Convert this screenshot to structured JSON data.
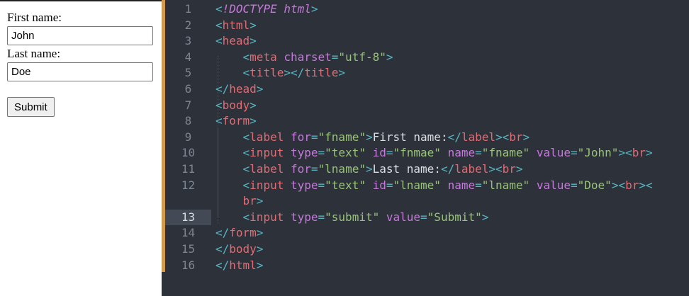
{
  "preview": {
    "first_name_label": "First name:",
    "first_name_value": "John",
    "last_name_label": "Last name:",
    "last_name_value": "Doe",
    "submit_label": "Submit"
  },
  "editor": {
    "active_line": 13,
    "lines": [
      {
        "n": "1",
        "indent": 0,
        "tokens": [
          [
            "p",
            "<"
          ],
          [
            "d",
            "!DOCTYPE html"
          ],
          [
            "p",
            ">"
          ]
        ]
      },
      {
        "n": "2",
        "indent": 0,
        "tokens": [
          [
            "p",
            "<"
          ],
          [
            "t",
            "html"
          ],
          [
            "p",
            ">"
          ]
        ]
      },
      {
        "n": "3",
        "indent": 0,
        "tokens": [
          [
            "p",
            "<"
          ],
          [
            "t",
            "head"
          ],
          [
            "p",
            ">"
          ]
        ]
      },
      {
        "n": "4",
        "indent": 1,
        "tokens": [
          [
            "p",
            "<"
          ],
          [
            "t",
            "meta"
          ],
          [
            "x",
            " "
          ],
          [
            "a",
            "charset"
          ],
          [
            "p",
            "="
          ],
          [
            "s",
            "\"utf-8\""
          ],
          [
            "p",
            ">"
          ]
        ]
      },
      {
        "n": "5",
        "indent": 1,
        "tokens": [
          [
            "p",
            "<"
          ],
          [
            "t",
            "title"
          ],
          [
            "p",
            "></"
          ],
          [
            "t",
            "title"
          ],
          [
            "p",
            ">"
          ]
        ]
      },
      {
        "n": "6",
        "indent": 0,
        "tokens": [
          [
            "p",
            "</"
          ],
          [
            "t",
            "head"
          ],
          [
            "p",
            ">"
          ]
        ]
      },
      {
        "n": "7",
        "indent": 0,
        "tokens": [
          [
            "p",
            "<"
          ],
          [
            "t",
            "body"
          ],
          [
            "p",
            ">"
          ]
        ]
      },
      {
        "n": "8",
        "indent": 0,
        "tokens": [
          [
            "p",
            "<"
          ],
          [
            "t",
            "form"
          ],
          [
            "p",
            ">"
          ]
        ]
      },
      {
        "n": "9",
        "indent": 1,
        "tokens": [
          [
            "p",
            "<"
          ],
          [
            "t",
            "label"
          ],
          [
            "x",
            " "
          ],
          [
            "a",
            "for"
          ],
          [
            "p",
            "="
          ],
          [
            "s",
            "\"fname\""
          ],
          [
            "p",
            ">"
          ],
          [
            "x",
            "First name:"
          ],
          [
            "p",
            "</"
          ],
          [
            "t",
            "label"
          ],
          [
            "p",
            "><"
          ],
          [
            "t",
            "br"
          ],
          [
            "p",
            ">"
          ]
        ]
      },
      {
        "n": "10",
        "indent": 1,
        "tokens": [
          [
            "p",
            "<"
          ],
          [
            "t",
            "input"
          ],
          [
            "x",
            " "
          ],
          [
            "a",
            "type"
          ],
          [
            "p",
            "="
          ],
          [
            "s",
            "\"text\""
          ],
          [
            "x",
            " "
          ],
          [
            "a",
            "id"
          ],
          [
            "p",
            "="
          ],
          [
            "s",
            "\"fnmae\""
          ],
          [
            "x",
            " "
          ],
          [
            "a",
            "name"
          ],
          [
            "p",
            "="
          ],
          [
            "s",
            "\"fname\""
          ],
          [
            "x",
            " "
          ],
          [
            "a",
            "value"
          ],
          [
            "p",
            "="
          ],
          [
            "s",
            "\"John\""
          ],
          [
            "p",
            "><"
          ],
          [
            "t",
            "br"
          ],
          [
            "p",
            ">"
          ]
        ]
      },
      {
        "n": "11",
        "indent": 1,
        "tokens": [
          [
            "p",
            "<"
          ],
          [
            "t",
            "label"
          ],
          [
            "x",
            " "
          ],
          [
            "a",
            "for"
          ],
          [
            "p",
            "="
          ],
          [
            "s",
            "\"lname\""
          ],
          [
            "p",
            ">"
          ],
          [
            "x",
            "Last name:"
          ],
          [
            "p",
            "</"
          ],
          [
            "t",
            "label"
          ],
          [
            "p",
            "><"
          ],
          [
            "t",
            "br"
          ],
          [
            "p",
            ">"
          ]
        ]
      },
      {
        "n": "12",
        "indent": 1,
        "tokens": [
          [
            "p",
            "<"
          ],
          [
            "t",
            "input"
          ],
          [
            "x",
            " "
          ],
          [
            "a",
            "type"
          ],
          [
            "p",
            "="
          ],
          [
            "s",
            "\"text\""
          ],
          [
            "x",
            " "
          ],
          [
            "a",
            "id"
          ],
          [
            "p",
            "="
          ],
          [
            "s",
            "\"lname\""
          ],
          [
            "x",
            " "
          ],
          [
            "a",
            "name"
          ],
          [
            "p",
            "="
          ],
          [
            "s",
            "\"lname\""
          ],
          [
            "x",
            " "
          ],
          [
            "a",
            "value"
          ],
          [
            "p",
            "="
          ],
          [
            "s",
            "\"Doe\""
          ],
          [
            "p",
            "><"
          ],
          [
            "t",
            "br"
          ],
          [
            "p",
            "><"
          ]
        ]
      },
      {
        "n": "",
        "indent": 1,
        "tokens": [
          [
            "t",
            "br"
          ],
          [
            "p",
            ">"
          ]
        ]
      },
      {
        "n": "13",
        "indent": 1,
        "tokens": [
          [
            "p",
            "<"
          ],
          [
            "t",
            "input"
          ],
          [
            "x",
            " "
          ],
          [
            "a",
            "type"
          ],
          [
            "p",
            "="
          ],
          [
            "s",
            "\"submit\""
          ],
          [
            "x",
            " "
          ],
          [
            "a",
            "value"
          ],
          [
            "p",
            "="
          ],
          [
            "s",
            "\"Submit\""
          ],
          [
            "p",
            ">"
          ]
        ]
      },
      {
        "n": "14",
        "indent": 0,
        "tokens": [
          [
            "p",
            "</"
          ],
          [
            "t",
            "form"
          ],
          [
            "p",
            ">"
          ]
        ]
      },
      {
        "n": "15",
        "indent": 0,
        "tokens": [
          [
            "p",
            "</"
          ],
          [
            "t",
            "body"
          ],
          [
            "p",
            ">"
          ]
        ]
      },
      {
        "n": "16",
        "indent": 0,
        "tokens": [
          [
            "p",
            "</"
          ],
          [
            "t",
            "html"
          ],
          [
            "p",
            ">"
          ]
        ]
      }
    ]
  },
  "colors": {
    "editor_bg": "#2d3139",
    "accent_bar": "#d19a4d",
    "tag": "#e06c75",
    "punctuation": "#56b6c2",
    "attribute": "#c678dd",
    "string": "#98c379",
    "text": "#dcdfe4"
  }
}
